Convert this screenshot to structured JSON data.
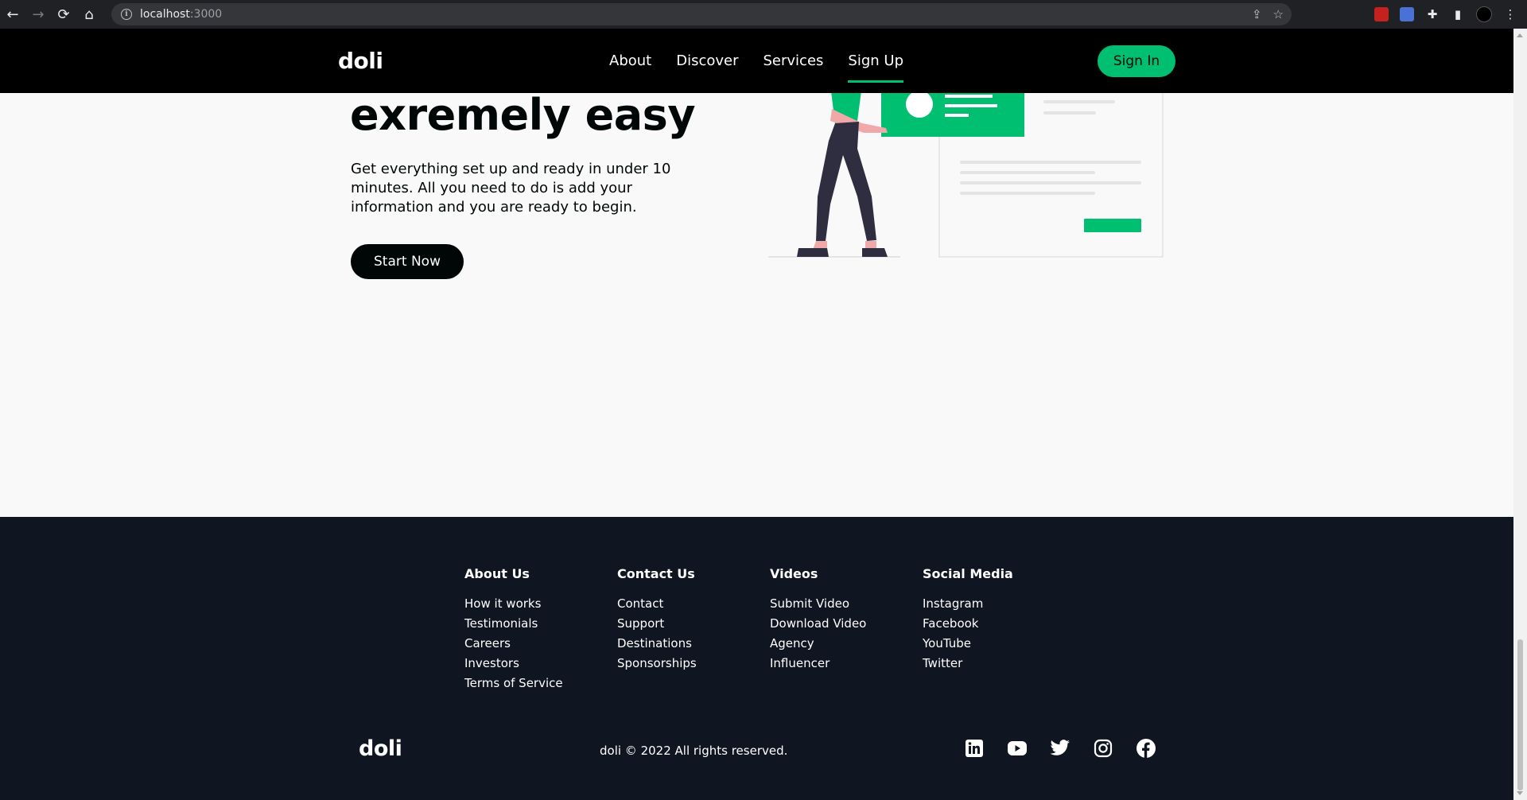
{
  "browser": {
    "url_host": "localhost",
    "url_port": ":3000"
  },
  "header": {
    "logo": "doli",
    "nav": [
      "About",
      "Discover",
      "Services",
      "Sign Up"
    ],
    "signin_label": "Sign In"
  },
  "hero": {
    "title": "exremely easy",
    "description": "Get everything set up and ready in under 10 minutes. All you need to do is add your information and you are ready to begin.",
    "cta_label": "Start Now"
  },
  "footer": {
    "columns": [
      {
        "title": "About Us",
        "links": [
          "How it works",
          "Testimonials",
          "Careers",
          "Investors",
          "Terms of Service"
        ]
      },
      {
        "title": "Contact Us",
        "links": [
          "Contact",
          "Support",
          "Destinations",
          "Sponsorships"
        ]
      },
      {
        "title": "Videos",
        "links": [
          "Submit Video",
          "Download Video",
          "Agency",
          "Influencer"
        ]
      },
      {
        "title": "Social Media",
        "links": [
          "Instagram",
          "Facebook",
          "YouTube",
          "Twitter"
        ]
      }
    ],
    "logo": "doli",
    "copyright": "doli © 2022 All rights reserved.",
    "social_icons": [
      "linkedin-icon",
      "youtube-icon",
      "twitter-icon",
      "instagram-icon",
      "facebook-icon"
    ]
  },
  "colors": {
    "accent": "#01bf71",
    "header_bg": "#000000",
    "footer_bg": "#101522",
    "page_bg": "#f9f9f9"
  }
}
